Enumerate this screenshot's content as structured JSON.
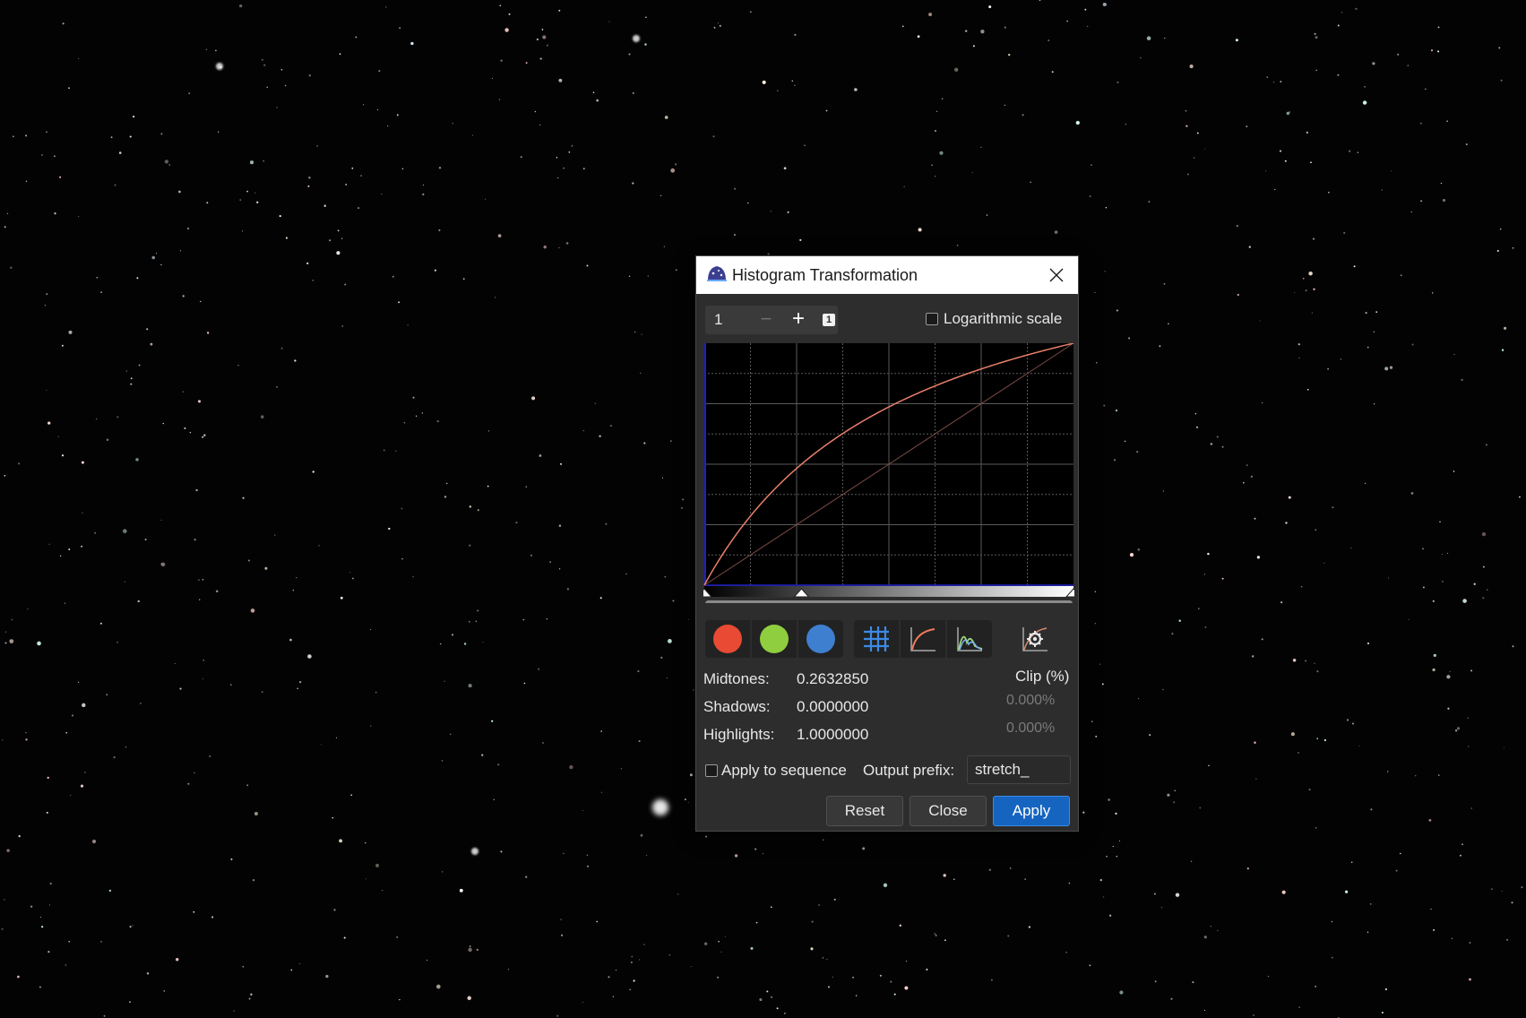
{
  "window": {
    "title": "Histogram Transformation",
    "close_icon": "close-icon",
    "app_icon": "siril-app-icon"
  },
  "zoom": {
    "value": "1",
    "minus_label": "−",
    "plus_label": "+",
    "badge": "1"
  },
  "log_scale": {
    "label": "Logarithmic scale",
    "checked": false
  },
  "curve": {
    "midtones": 0.263285,
    "shadows": 0.0,
    "highlights": 1.0,
    "curve_color": "#e8806a",
    "identity_color": "#7a4a44",
    "grid_divisions": 8
  },
  "toolbar": {
    "channels": [
      {
        "name": "red-channel-toggle",
        "color": "#e84a33"
      },
      {
        "name": "green-channel-toggle",
        "color": "#8fce3e"
      },
      {
        "name": "blue-channel-toggle",
        "color": "#3f7fd0"
      }
    ],
    "views": [
      {
        "name": "grid-toggle-icon"
      },
      {
        "name": "curve-toggle-icon"
      },
      {
        "name": "histogram-toggle-icon"
      }
    ],
    "auto_stretch_icon": "auto-stretch-icon"
  },
  "params": {
    "midtones_label": "Midtones:",
    "midtones_value": "0.2632850",
    "shadows_label": "Shadows:",
    "shadows_value": "0.0000000",
    "highlights_label": "Highlights:",
    "highlights_value": "1.0000000",
    "clip_header": "Clip (%)",
    "shadows_clip": "0.000%",
    "highlights_clip": "0.000%"
  },
  "sequence": {
    "apply_label": "Apply to sequence",
    "checked": false,
    "prefix_label": "Output prefix:",
    "prefix_value": "stretch_"
  },
  "buttons": {
    "reset": "Reset",
    "close": "Close",
    "apply": "Apply"
  },
  "colors": {
    "accent": "#1565c0",
    "dialog_bg": "#2d2d2d"
  }
}
